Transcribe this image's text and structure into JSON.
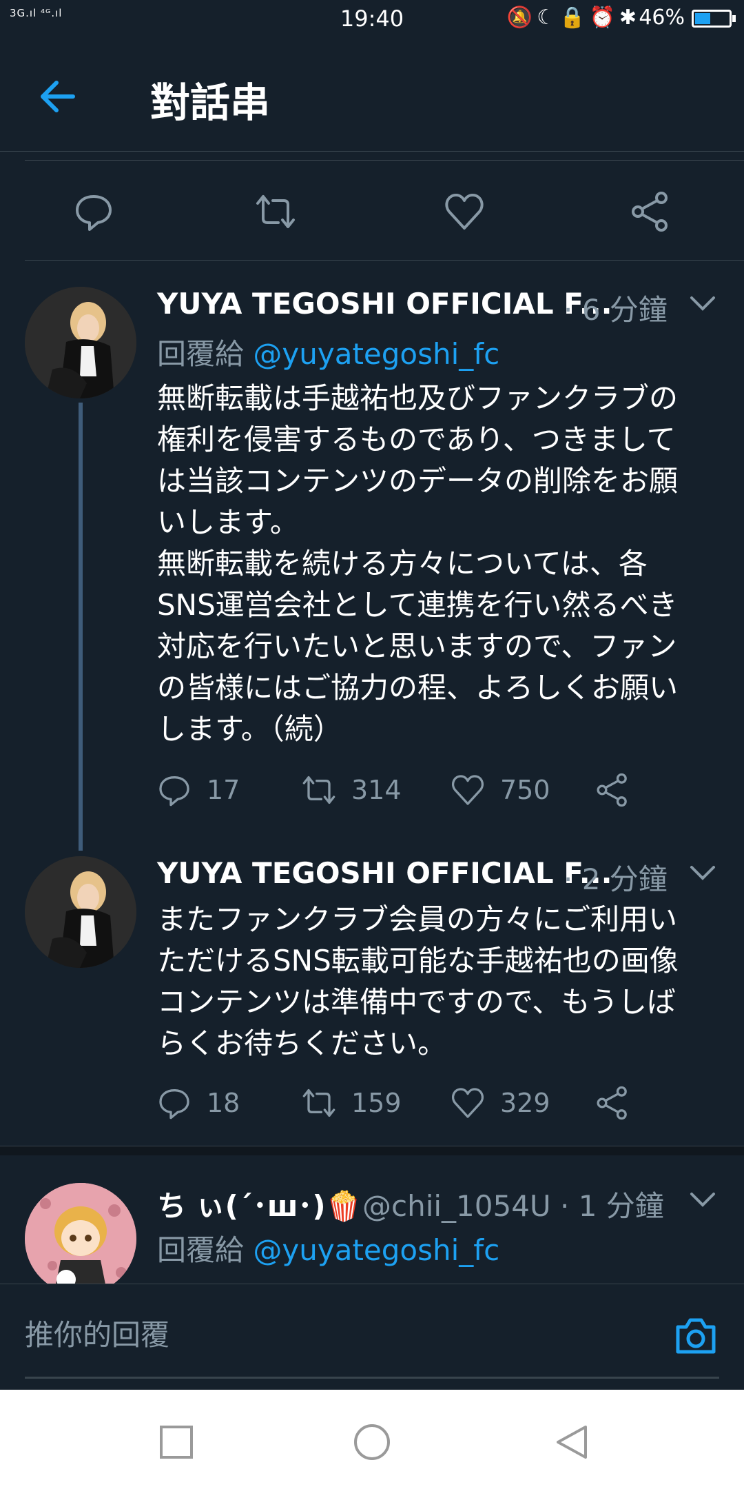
{
  "status_bar": {
    "network": "3G.ıl ⁴ᴳ.ıl",
    "time": "19:40",
    "icons_text": "🔕☾🔒⏰✱",
    "battery": "46%"
  },
  "header": {
    "title": "對話串"
  },
  "tweets": [
    {
      "name": "YUYA TEGOSHI OFFICIAL F...",
      "time": "· 6 分鐘",
      "reply_prefix": "回覆給",
      "reply_handle": "@yuyategoshi_fc",
      "text": "無断転載は手越祐也及びファンクラブの\n権利を侵害するものであり、つきまして\nは当該コンテンツのデータの削除をお願\nいします。\n無断転載を続ける方々については、各\nSNS運営会社として連携を行い然るべき\n対応を行いたいと思いますので、ファン\nの皆様にはご協力の程、よろしくお願い\nします。（続）",
      "replies": "17",
      "retweets": "314",
      "likes": "750"
    },
    {
      "name": "YUYA TEGOSHI OFFICIAL F...",
      "time": "· 2 分鐘",
      "text": "またファンクラブ会員の方々にご利用い\nただけるSNS転載可能な手越祐也の画像\nコンテンツは準備中ですので、もうしば\nらくお待ちください。",
      "replies": "18",
      "retweets": "159",
      "likes": "329"
    },
    {
      "name": "ち ぃ(´･ш･)🍿",
      "handle_time": "@chii_1054U · 1 分鐘",
      "reply_prefix": "回覆給",
      "reply_handle": "@yuyategoshi_fc"
    }
  ],
  "reply_bar": {
    "placeholder": "推你的回覆"
  },
  "colors": {
    "background": "#15202b",
    "accent": "#1da1f2",
    "muted": "#8899a6",
    "divider": "#38444d"
  }
}
